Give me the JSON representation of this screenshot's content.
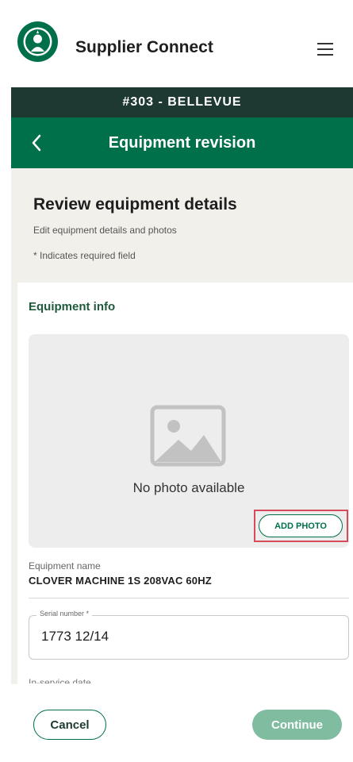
{
  "app": {
    "name": "Supplier Connect",
    "logo_icon": "starbucks-siren-logo-icon",
    "menu_icon": "hamburger-menu-icon"
  },
  "store_banner": "#303 - BELLEVUE",
  "page_header": {
    "back_icon": "chevron-left-icon",
    "title": "Equipment revision"
  },
  "review": {
    "title": "Review equipment details",
    "subtitle": "Edit equipment details and photos",
    "required_note": "* Indicates required field"
  },
  "equipment_info": {
    "section_title": "Equipment info",
    "photo": {
      "placeholder_icon": "image-placeholder-icon",
      "no_photo_text": "No photo available",
      "add_photo_label": "ADD PHOTO"
    },
    "equipment_name": {
      "label": "Equipment name",
      "value": "CLOVER MACHINE 1S 208VAC 60HZ"
    },
    "serial_number": {
      "label": "Serial number *",
      "value": "1773 12/14"
    },
    "in_service_date": {
      "label": "In-service date"
    }
  },
  "footer": {
    "cancel_label": "Cancel",
    "continue_label": "Continue"
  },
  "colors": {
    "brand_green": "#00704a",
    "banner_dark": "#1e3932",
    "continue_disabled": "#7fbca0",
    "highlight": "#d64a5a"
  }
}
